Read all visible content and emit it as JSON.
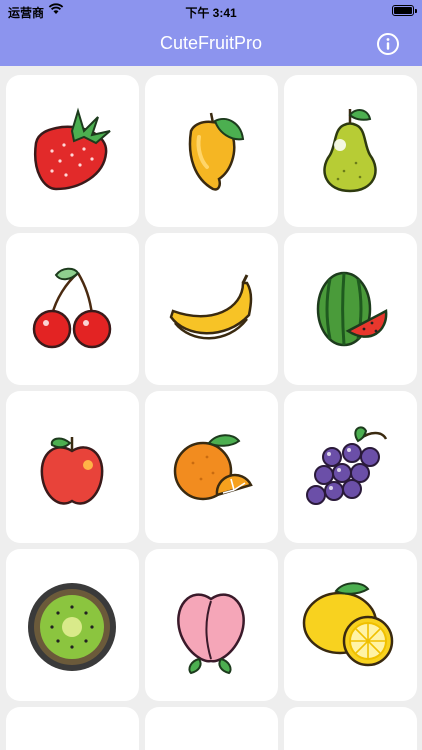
{
  "status_bar": {
    "carrier": "运营商",
    "time": "下午 3:41"
  },
  "nav": {
    "title": "CuteFruitPro",
    "info_icon": "info-icon"
  },
  "colors": {
    "nav_background": "#8c94ee",
    "page_background": "#eeeeee",
    "card_background": "#ffffff"
  },
  "fruits": [
    "strawberry",
    "mango",
    "pear",
    "cherry",
    "banana",
    "watermelon",
    "apple",
    "orange",
    "grape",
    "kiwi",
    "peach",
    "lemon"
  ]
}
